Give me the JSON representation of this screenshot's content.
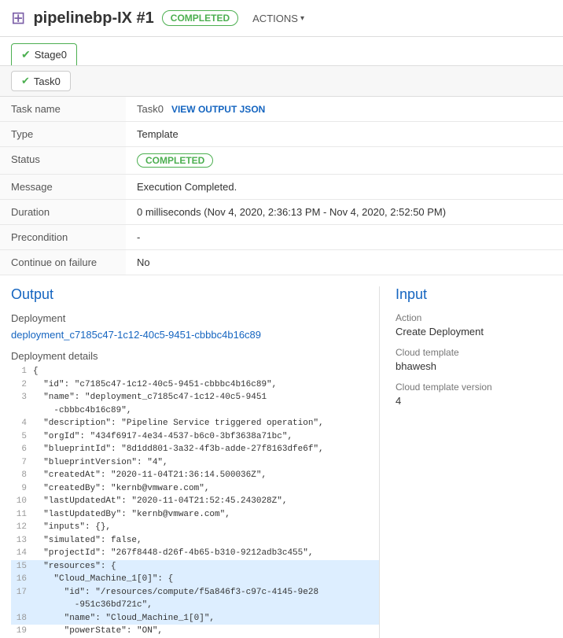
{
  "header": {
    "icon": "⊞",
    "title": "pipelinebp-IX #1",
    "completed_badge": "COMPLETED",
    "actions_label": "ACTIONS"
  },
  "stage_tab": {
    "check": "✔",
    "label": "Stage0"
  },
  "task_tab": {
    "check": "✔",
    "label": "Task0"
  },
  "info_rows": [
    {
      "label": "Task name",
      "value": "Task0",
      "has_link": true,
      "link_text": "VIEW OUTPUT JSON"
    },
    {
      "label": "Type",
      "value": "Template"
    },
    {
      "label": "Status",
      "value": "COMPLETED",
      "is_badge": true
    },
    {
      "label": "Message",
      "value": "Execution Completed."
    },
    {
      "label": "Duration",
      "value": "0 milliseconds (Nov 4, 2020, 2:36:13 PM - Nov 4, 2020, 2:52:50 PM)"
    },
    {
      "label": "Precondition",
      "value": "-"
    },
    {
      "label": "Continue on failure",
      "value": "No"
    }
  ],
  "output": {
    "title": "Output",
    "deployment_label": "Deployment",
    "deployment_link": "deployment_c7185c47-1c12-40c5-9451-cbbbc4b16c89",
    "details_label": "Deployment details",
    "code_lines": [
      {
        "num": "1",
        "content": "{",
        "highlight": false
      },
      {
        "num": "2",
        "content": "  \"id\": \"c7185c47-1c12-40c5-9451-cbbbc4b16c89\",",
        "highlight": false
      },
      {
        "num": "3",
        "content": "  \"name\": \"deployment_c7185c47-1c12-40c5-9451",
        "highlight": false
      },
      {
        "num": "",
        "content": "    -cbbbc4b16c89\",",
        "highlight": false
      },
      {
        "num": "4",
        "content": "  \"description\": \"Pipeline Service triggered operation\",",
        "highlight": false
      },
      {
        "num": "5",
        "content": "  \"orgId\": \"434f6917-4e34-4537-b6c0-3bf3638a71bc\",",
        "highlight": false
      },
      {
        "num": "6",
        "content": "  \"blueprintId\": \"8d1dd801-3a32-4f3b-adde-27f8163dfe6f\",",
        "highlight": false
      },
      {
        "num": "7",
        "content": "  \"blueprintVersion\": \"4\",",
        "highlight": false
      },
      {
        "num": "8",
        "content": "  \"createdAt\": \"2020-11-04T21:36:14.500036Z\",",
        "highlight": false
      },
      {
        "num": "9",
        "content": "  \"createdBy\": \"kernb@vmware.com\",",
        "highlight": false
      },
      {
        "num": "10",
        "content": "  \"lastUpdatedAt\": \"2020-11-04T21:52:45.243028Z\",",
        "highlight": false
      },
      {
        "num": "11",
        "content": "  \"lastUpdatedBy\": \"kernb@vmware.com\",",
        "highlight": false
      },
      {
        "num": "12",
        "content": "  \"inputs\": {},",
        "highlight": false
      },
      {
        "num": "13",
        "content": "  \"simulated\": false,",
        "highlight": false
      },
      {
        "num": "14",
        "content": "  \"projectId\": \"267f8448-d26f-4b65-b310-9212adb3c455\",",
        "highlight": false
      },
      {
        "num": "15",
        "content": "  \"resources\": {",
        "highlight": true
      },
      {
        "num": "16",
        "content": "    \"Cloud_Machine_1[0]\": {",
        "highlight": true
      },
      {
        "num": "17",
        "content": "      \"id\": \"/resources/compute/f5a846f3-c97c-4145-9e28",
        "highlight": true
      },
      {
        "num": "",
        "content": "        -951c36bd721c\",",
        "highlight": true
      },
      {
        "num": "18",
        "content": "      \"name\": \"Cloud_Machine_1[0]\",",
        "highlight": true
      },
      {
        "num": "19",
        "content": "      \"powerState\": \"ON\",",
        "highlight": false
      }
    ]
  },
  "input": {
    "title": "Input",
    "action_label": "Action",
    "action_value": "Create Deployment",
    "cloud_template_label": "Cloud template",
    "cloud_template_value": "bhawesh",
    "cloud_template_version_label": "Cloud template version",
    "cloud_template_version_value": "4"
  }
}
